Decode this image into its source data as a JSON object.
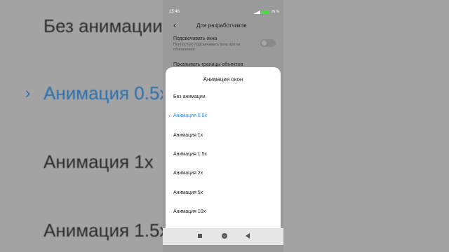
{
  "status": {
    "time": "15:46",
    "battery": "76 %"
  },
  "header": {
    "title": "Для разработчиков"
  },
  "settings": {
    "item1": {
      "title": "Подсвечивать окна",
      "subtitle": "Полностью подсвечивать окна при их обновлении"
    },
    "item2": {
      "title": "Показывать границы объектов"
    }
  },
  "dialog": {
    "title": "Анимация окон",
    "options": [
      {
        "label": "Без анимации",
        "selected": false
      },
      {
        "label": "Анимация 0.5x",
        "selected": true
      },
      {
        "label": "Анимация 1x",
        "selected": false
      },
      {
        "label": "Анимация 1.5x",
        "selected": false
      },
      {
        "label": "Анимация 2x",
        "selected": false
      },
      {
        "label": "Анимация 5x",
        "selected": false
      },
      {
        "label": "Анимация 10x",
        "selected": false
      }
    ]
  },
  "colors": {
    "accent": "#2b8be0"
  }
}
